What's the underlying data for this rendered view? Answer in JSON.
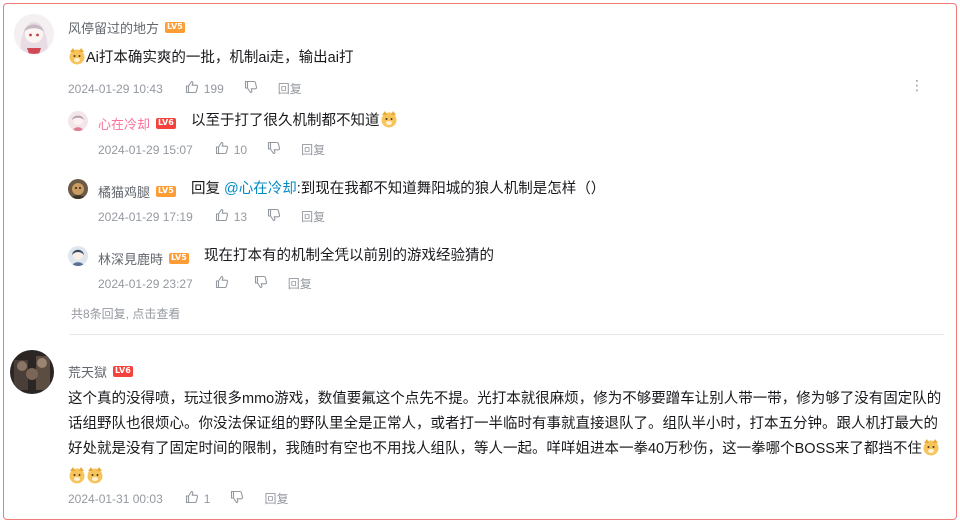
{
  "thread": {
    "author": {
      "name": "风停留过的地方",
      "level": "LV5"
    },
    "text": "Ai打本确实爽的一批，机制ai走，输出ai打",
    "time": "2024-01-29 10:43",
    "likes": "199",
    "reply_label": "回复",
    "more_icon": "⋮",
    "replies": [
      {
        "name": "心在冷却",
        "level": "LV6",
        "text": "以至于打了很久机制都不知道",
        "time": "2024-01-29 15:07",
        "likes": "10",
        "reply_label": "回复"
      },
      {
        "name": "橘猫鸡腿",
        "level": "LV5",
        "reply_prefix": "回复",
        "mention": "@心在冷却",
        "colon": ":",
        "text": "到现在我都不知道舞阳城的狼人机制是怎样（）",
        "time": "2024-01-29 17:19",
        "likes": "13",
        "reply_label": "回复"
      },
      {
        "name": "林深見鹿時",
        "level": "LV5",
        "text": "现在打本有的机制全凭以前别的游戏经验猜的",
        "time": "2024-01-29 23:27",
        "likes": "",
        "reply_label": "回复"
      }
    ],
    "view_more": {
      "count_text": "共8条回复,",
      "link_text": "点击查看"
    }
  },
  "comment2": {
    "author": {
      "name": "荒天獄",
      "level": "LV6"
    },
    "lines": [
      "这个真的没得喷，玩过很多mmo游戏，数值要氟这个点先不提。光打本就很麻烦，修为不够要蹭车让别人带一带，修为够了没有固定队的",
      "话组野队也很烦心。你没法保证组的野队里全是正常人，或者打一半临时有事就直接退队了。组队半小时，打本五分钟。跟人机打最大的",
      "好处就是没有了固定时间的限制，我随时有空也不用找人组队，等人一起。咩咩姐进本一拳40万秒伤，这一拳哪个BOSS来了都挡不住"
    ],
    "time": "2024-01-31 00:03",
    "likes": "1",
    "reply_label": "回复"
  },
  "colors": {
    "accent_blue": "#008ac5",
    "level_orange": "#ff9c35",
    "level_red": "#f5423c",
    "pink_name": "#fb7299",
    "frame_border": "#f07a7a"
  },
  "icons": [
    "thumb-up-icon",
    "thumb-down-icon",
    "more-vertical-icon",
    "doge-emoji-icon"
  ]
}
